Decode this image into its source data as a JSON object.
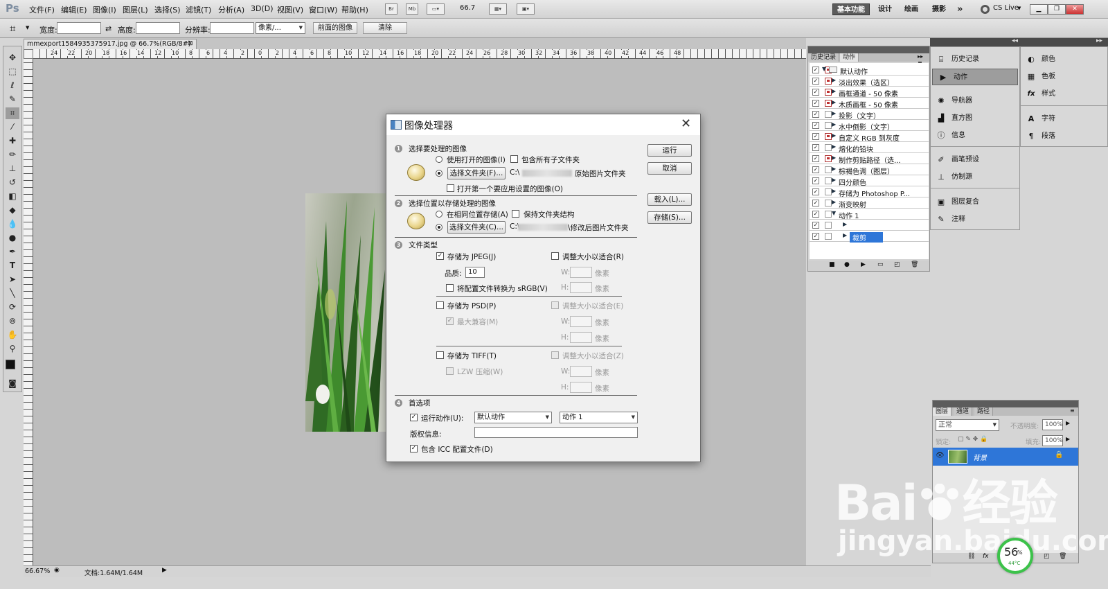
{
  "app": {
    "logo": "Ps"
  },
  "menus": [
    "文件(F)",
    "编辑(E)",
    "图像(I)",
    "图层(L)",
    "选择(S)",
    "滤镜(T)",
    "分析(A)",
    "3D(D)",
    "视图(V)",
    "窗口(W)",
    "帮助(H)"
  ],
  "appbar": {
    "br": "Br",
    "mb": "Mb",
    "zoom": "66.7"
  },
  "workspaces": [
    "基本功能",
    "设计",
    "绘画",
    "摄影"
  ],
  "more": "»",
  "cslive": "CS Live",
  "options": {
    "width_label": "宽度:",
    "height_label": "高度:",
    "resolution_label": "分辨率:",
    "unit": "像素/...",
    "front_image": "前面的图像",
    "clear": "清除"
  },
  "document": {
    "tab": "mmexport1584935375917.jpg @ 66.7%(RGB/8#) *"
  },
  "ruler_labels": [
    "24",
    "22",
    "20",
    "18",
    "16",
    "14",
    "12",
    "10",
    "8",
    "6",
    "4",
    "2",
    "0",
    "2",
    "4",
    "6",
    "8",
    "10",
    "12",
    "14",
    "16",
    "18",
    "20",
    "22",
    "24",
    "26",
    "28",
    "30",
    "32",
    "34",
    "36",
    "38",
    "40",
    "42",
    "44",
    "46",
    "48"
  ],
  "status": {
    "zoom": "66.67%",
    "doc": "文档:1.64M/1.64M"
  },
  "dialog": {
    "title": "图像处理器",
    "s1": {
      "num": "1",
      "title": "选择要处理的图像",
      "use_open": "使用打开的图像(I)",
      "include_sub": "包含所有子文件夹",
      "select_folder": "选择文件夹(F)...",
      "path_prefix": "C:\\",
      "path_suffix": "原始图片文件夹",
      "open_first": "打开第一个要应用设置的图像(O)"
    },
    "s2": {
      "num": "2",
      "title": "选择位置以存储处理的图像",
      "same_loc": "在相同位置存储(A)",
      "keep_struct": "保持文件夹结构",
      "select_folder": "选择文件夹(C)...",
      "path_prefix": "C:\\",
      "path_suffix": "\\修改后图片文件夹"
    },
    "s3": {
      "num": "3",
      "title": "文件类型",
      "save_jpeg": "存储为 JPEG(J)",
      "resize_r": "调整大小以适合(R)",
      "quality_label": "品质:",
      "quality_value": "10",
      "convert_srgb": "将配置文件转换为 sRGB(V)",
      "save_psd": "存储为 PSD(P)",
      "resize_e": "调整大小以适合(E)",
      "max_compat": "最大兼容(M)",
      "save_tiff": "存储为 TIFF(T)",
      "resize_z": "调整大小以适合(Z)",
      "lzw": "LZW 压缩(W)",
      "w": "W:",
      "h": "H:",
      "px": "像素"
    },
    "s4": {
      "num": "4",
      "title": "首选项",
      "run_action": "运行动作(U):",
      "action_set": "默认动作",
      "action": "动作 1",
      "copyright": "版权信息:",
      "include_icc": "包含 ICC 配置文件(D)"
    },
    "buttons": {
      "run": "运行",
      "cancel": "取消",
      "load": "载入(L)...",
      "save": "存储(S)..."
    }
  },
  "actions_panel": {
    "tabs": [
      "历史记录",
      "动作"
    ],
    "rows": [
      {
        "label": "默认动作",
        "level": 0,
        "red": true
      },
      {
        "label": "淡出效果（选区）",
        "level": 1,
        "red": true
      },
      {
        "label": "画框通道 - 50 像素",
        "level": 1,
        "red": true
      },
      {
        "label": "木质画框 - 50 像素",
        "level": 1,
        "red": true
      },
      {
        "label": "投影（文字）",
        "level": 1,
        "red": false
      },
      {
        "label": "水中倒影（文字）",
        "level": 1,
        "red": false
      },
      {
        "label": "自定义 RGB 到灰度",
        "level": 1,
        "red": true
      },
      {
        "label": "熔化的铅块",
        "level": 1,
        "red": false
      },
      {
        "label": "制作剪贴路径（选...",
        "level": 1,
        "red": true
      },
      {
        "label": "棕褐色调（图层）",
        "level": 1,
        "red": false
      },
      {
        "label": "四分颜色",
        "level": 1,
        "red": false
      },
      {
        "label": "存储为 Photoshop P...",
        "level": 1,
        "red": false
      },
      {
        "label": "渐变映射",
        "level": 1,
        "red": false
      },
      {
        "label": "动作 1",
        "level": 1,
        "red": false
      },
      {
        "label": "",
        "level": 2,
        "red": false
      },
      {
        "label": "裁剪",
        "level": 2,
        "red": false
      }
    ]
  },
  "dock_left": [
    "历史记录",
    "动作",
    "导航器",
    "直方图",
    "信息",
    "画笔预设",
    "仿制源",
    "图层复合",
    "注释"
  ],
  "dock_right": [
    "颜色",
    "色板",
    "样式",
    "字符",
    "段落"
  ],
  "layers_panel": {
    "tabs": [
      "图层",
      "通道",
      "路径"
    ],
    "blend": "正常",
    "opacity_label": "不透明度:",
    "opacity": "100%",
    "lock_label": "锁定:",
    "fill_label": "填充:",
    "fill": "100%",
    "layer_name": "背景"
  },
  "watermark": {
    "brand": "Bai",
    "brand2": "经验",
    "url": "jingyan.baidu.com"
  },
  "temp_badge": {
    "value": "56",
    "unit": "%",
    "temp": "44°C"
  }
}
